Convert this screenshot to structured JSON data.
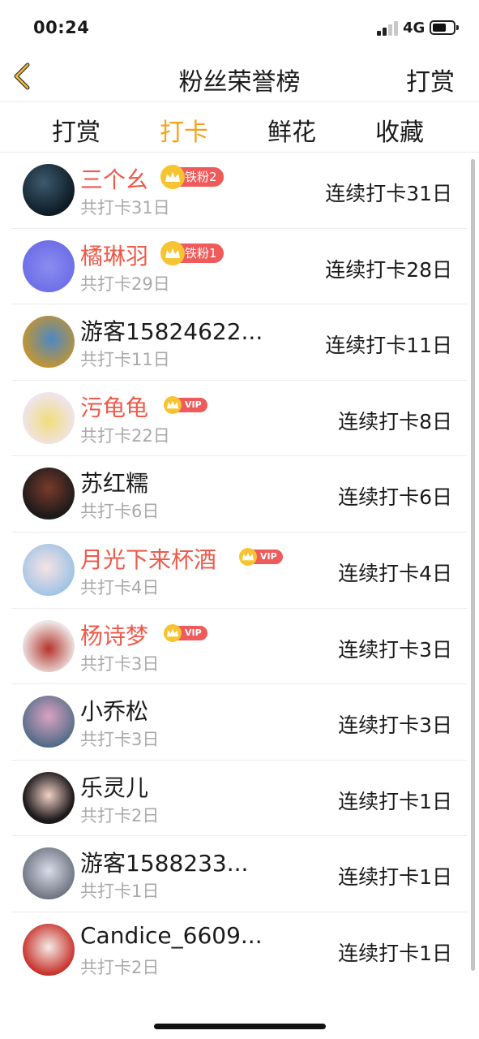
{
  "status_bar": {
    "time": "00:24",
    "network": "4G"
  },
  "nav": {
    "title": "粉丝荣誉榜",
    "action_label": "打赏",
    "back_icon": "chevron-left-icon"
  },
  "tabs": [
    {
      "label": "打赏",
      "active": false
    },
    {
      "label": "打卡",
      "active": true
    },
    {
      "label": "鲜花",
      "active": false
    },
    {
      "label": "收藏",
      "active": false
    }
  ],
  "colors": {
    "accent": "#f5a21b",
    "vip_name": "#ef5a4a",
    "badge": "#ef5a5a",
    "crown": "#f7c431",
    "muted": "#a9a9a9"
  },
  "rows": [
    {
      "name": "三个幺",
      "badge_type": "fan",
      "badge": "铁粉2",
      "total": "共打卡31日",
      "streak": "连续打卡31日"
    },
    {
      "name": "橘琳羽",
      "badge_type": "fan",
      "badge": "铁粉1",
      "total": "共打卡29日",
      "streak": "连续打卡28日"
    },
    {
      "name": "游客15824622...",
      "badge_type": "",
      "badge": "",
      "total": "共打卡11日",
      "streak": "连续打卡11日"
    },
    {
      "name": "污龟龟",
      "badge_type": "vip",
      "badge": "VIP",
      "total": "共打卡22日",
      "streak": "连续打卡8日"
    },
    {
      "name": "苏红糯",
      "badge_type": "",
      "badge": "",
      "total": "共打卡6日",
      "streak": "连续打卡6日"
    },
    {
      "name": "月光下来杯酒",
      "badge_type": "vip",
      "badge": "VIP",
      "total": "共打卡4日",
      "streak": "连续打卡4日"
    },
    {
      "name": "杨诗梦",
      "badge_type": "vip",
      "badge": "VIP",
      "total": "共打卡3日",
      "streak": "连续打卡3日"
    },
    {
      "name": "小乔松",
      "badge_type": "",
      "badge": "",
      "total": "共打卡3日",
      "streak": "连续打卡3日"
    },
    {
      "name": "乐灵儿",
      "badge_type": "",
      "badge": "",
      "total": "共打卡2日",
      "streak": "连续打卡1日"
    },
    {
      "name": "游客1588233...",
      "badge_type": "",
      "badge": "",
      "total": "共打卡1日",
      "streak": "连续打卡1日"
    },
    {
      "name": "Candice_6609...",
      "badge_type": "",
      "badge": "",
      "total": "共打卡2日",
      "streak": "连续打卡1日"
    }
  ]
}
